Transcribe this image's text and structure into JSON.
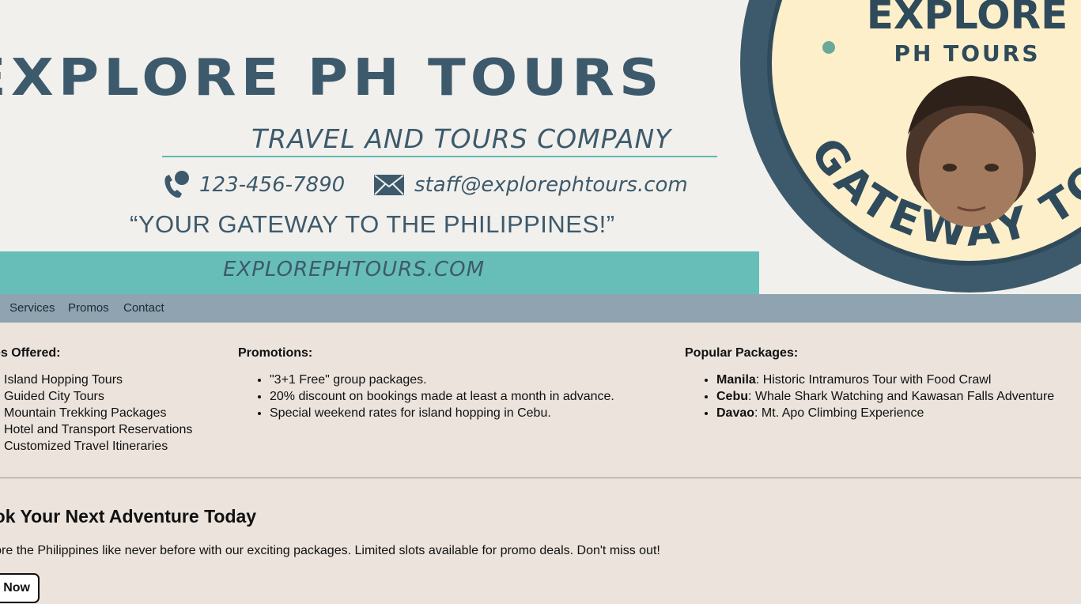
{
  "banner": {
    "title": "EXPLORE PH TOURS",
    "subtitle": "TRAVEL AND TOURS COMPANY",
    "phone": "123-456-7890",
    "email": "staff@explorephtours.com",
    "tagline": "“YOUR GATEWAY TO THE PHILIPPINES!”",
    "website": "EXPLOREPHTOURS.COM",
    "logo": {
      "top_text_1": "EXPLORE",
      "top_text_2": "PH TOURS",
      "ring_text": "GATEWAY TO THE PHILIPPINES"
    },
    "colors": {
      "navy": "#3d5a6c",
      "teal": "#67beb9",
      "cream": "#fcefc9"
    }
  },
  "nav": {
    "items": [
      {
        "label": "Services"
      },
      {
        "label": "Promos"
      },
      {
        "label": "Contact"
      }
    ]
  },
  "services": {
    "heading": "Services Offered:",
    "items": [
      "Island Hopping Tours",
      "Guided City Tours",
      "Mountain Trekking Packages",
      "Hotel and Transport Reservations",
      "Customized Travel Itineraries"
    ]
  },
  "promotions": {
    "heading": "Promotions:",
    "items": [
      "\"3+1 Free\" group packages.",
      "20% discount on bookings made at least a month in advance.",
      "Special weekend rates for island hopping in Cebu."
    ]
  },
  "packages": {
    "heading": "Popular Packages:",
    "items": [
      {
        "place": "Manila",
        "desc": ": Historic Intramuros Tour with Food Crawl"
      },
      {
        "place": "Cebu",
        "desc": ": Whale Shark Watching and Kawasan Falls Adventure"
      },
      {
        "place": "Davao",
        "desc": ": Mt. Apo Climbing Experience"
      }
    ]
  },
  "cta": {
    "heading": "Book Your Next Adventure Today",
    "text": "Explore the Philippines like never before with our exciting packages. Limited slots available for promo deals. Don't miss out!",
    "button": "Book Now"
  }
}
